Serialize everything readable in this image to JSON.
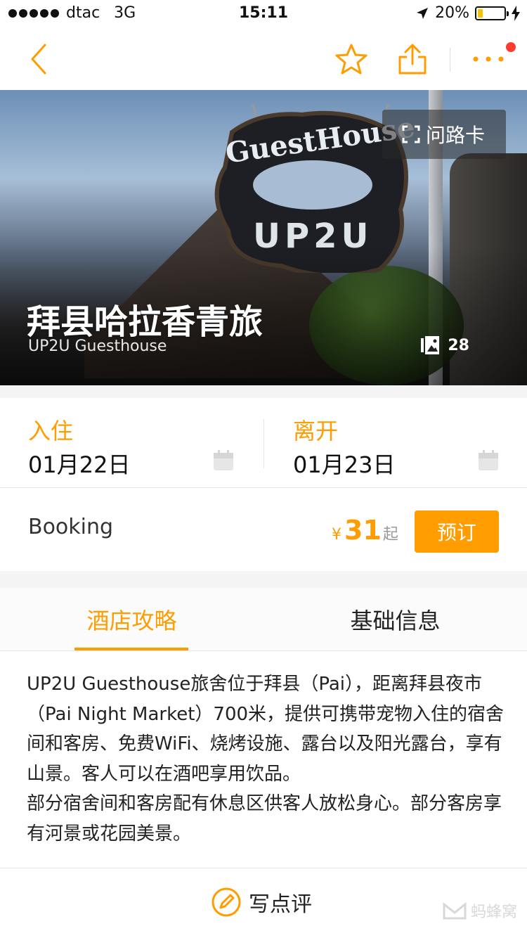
{
  "status_bar": {
    "carrier": "dtac",
    "network": "3G",
    "time": "15:11",
    "battery": "20%",
    "battery_level": 0.2
  },
  "hero": {
    "sign_top_text": "GuestHouse",
    "sign_main_text": "UP2U",
    "map_card_label": "问路卡",
    "title": "拜县哈拉香青旅",
    "subtitle": "UP2U Guesthouse",
    "photo_count": "28"
  },
  "dates": {
    "checkin_label": "入住",
    "checkin_date": "01月22日",
    "checkout_label": "离开",
    "checkout_date": "01月23日"
  },
  "booking": {
    "provider": "Booking",
    "currency": "¥",
    "price": "31",
    "price_suffix": "起",
    "book_label": "预订"
  },
  "tabs": [
    {
      "label": "酒店攻略"
    },
    {
      "label": "基础信息"
    }
  ],
  "description": {
    "paragraph1": "UP2U Guesthouse旅舍位于拜县（Pai），距离拜县夜市（Pai Night Market）700米，提供可携带宠物入住的宿舍间和客房、免费WiFi、烧烤设施、露台以及阳光露台，享有山景。客人可以在酒吧享用饮品。",
    "paragraph2": "部分宿舍间和客房配有休息区供客人放松身心。部分客房享有河景或花园美景。"
  },
  "bottom_bar": {
    "review_label": "写点评",
    "watermark": "蚂蜂窝"
  },
  "colors": {
    "accent": "#ff9d00",
    "notification": "#ff3b30"
  },
  "icons": [
    "back-arrow-icon",
    "star-icon",
    "share-icon",
    "more-icon",
    "expand-icon",
    "photos-icon",
    "calendar-icon",
    "pen-icon",
    "location-arrow-icon",
    "charging-icon"
  ]
}
